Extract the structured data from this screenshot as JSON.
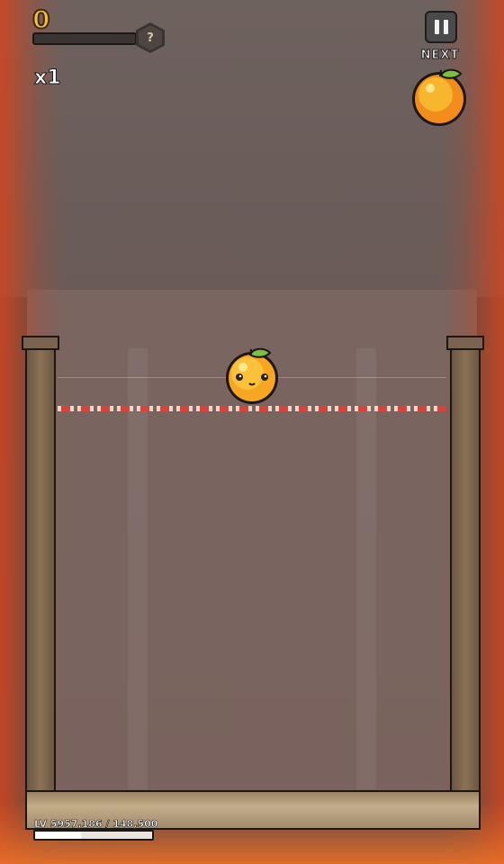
{
  "hud": {
    "score": "0",
    "score_progress": 0,
    "mystery_badge": "?",
    "multiplier": "x1"
  },
  "next_panel": {
    "label": "NEXT",
    "fruit_icon": "orange-icon"
  },
  "play_area": {
    "active_fruit_icon": "orange-icon",
    "danger_line_colors": [
      "#f0d6cc",
      "#d8443a"
    ]
  },
  "level": {
    "text": "LV 5957,186 / 148,500",
    "progress": 0.39
  },
  "colors": {
    "score": "#f3bf3a",
    "fruit": "#f6a623",
    "leaf": "#7bc043",
    "edge_glow": "#d2461e"
  }
}
